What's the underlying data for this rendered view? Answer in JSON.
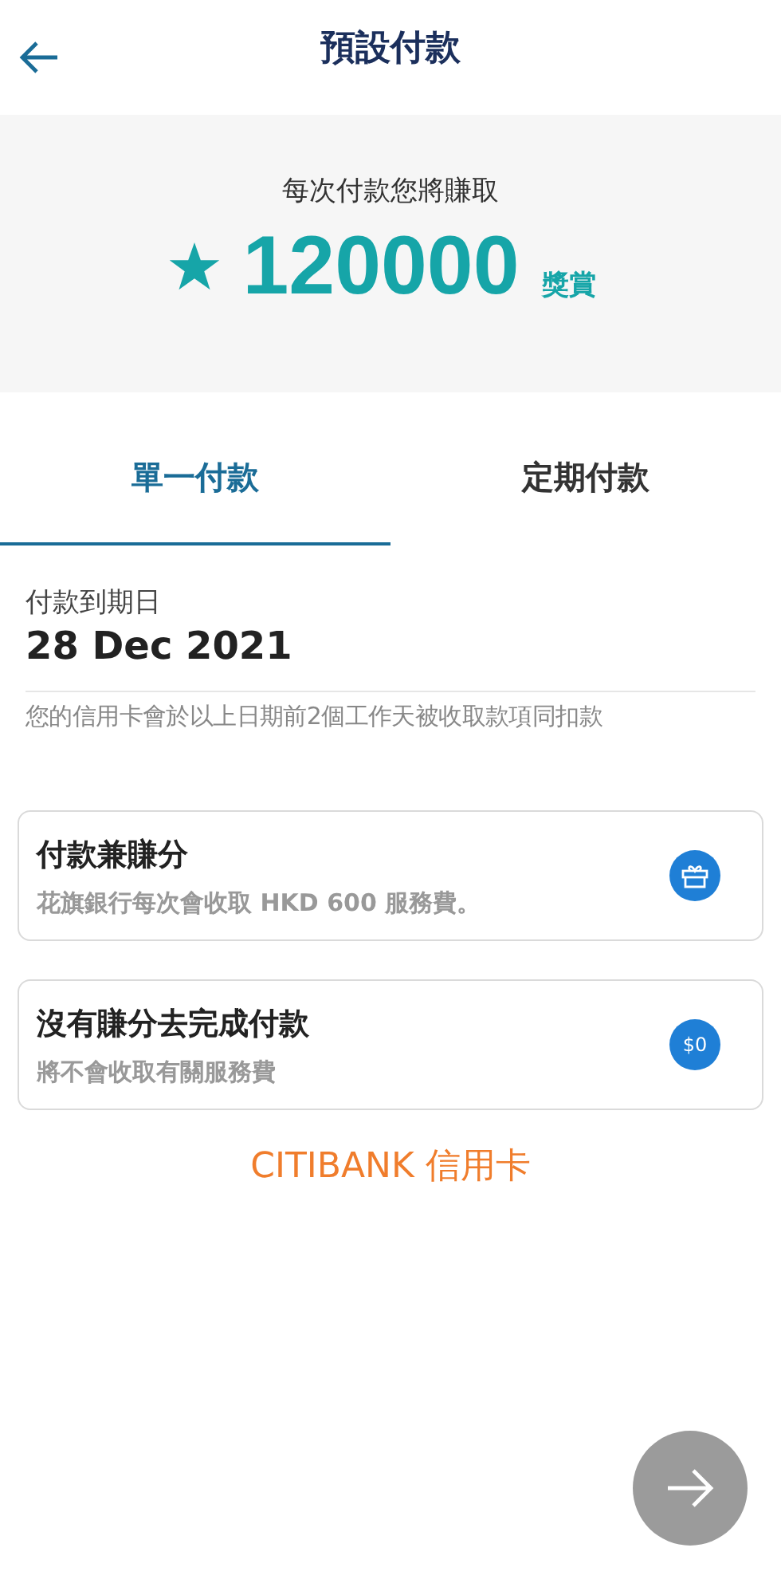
{
  "header": {
    "title": "預設付款"
  },
  "rewards": {
    "caption": "每次付款您將賺取",
    "amount": "120000",
    "unit": "獎賞"
  },
  "tabs": [
    {
      "label": "單一付款",
      "selected": true
    },
    {
      "label": "定期付款",
      "selected": false
    }
  ],
  "due": {
    "label": "付款到期日",
    "date": "28 Dec 2021",
    "note": "您的信用卡會於以上日期前2個工作天被收取款項同扣款"
  },
  "options": [
    {
      "kind": "gift",
      "title": "付款兼賺分",
      "subtitle": "花旗銀行每次會收取 HKD 600 服務費。"
    },
    {
      "kind": "fee",
      "title": "沒有賺分去完成付款",
      "subtitle": "將不會收取有關服務費",
      "badge_text": "$0"
    }
  ],
  "card_name": "CITIBANK 信用卡",
  "next_button": {
    "disabled": true
  }
}
